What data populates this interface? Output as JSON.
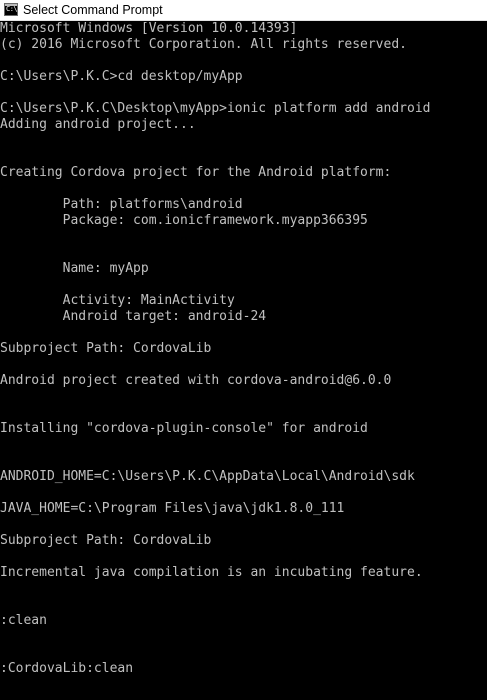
{
  "window": {
    "title": "Select Command Prompt",
    "icon_label": "C:\\"
  },
  "console": {
    "lines": [
      "Microsoft Windows [Version 10.0.14393]",
      "(c) 2016 Microsoft Corporation. All rights reserved.",
      "C:\\Users\\P.K.C>cd desktop/myApp",
      "C:\\Users\\P.K.C\\Desktop\\myApp>ionic platform add android",
      "Adding android project...",
      "Creating Cordova project for the Android platform:",
      "        Path: platforms\\android",
      "        Package: com.ionicframework.myapp366395",
      "        Name: myApp",
      "        Activity: MainActivity",
      "        Android target: android-24",
      "Subproject Path: CordovaLib",
      "Android project created with cordova-android@6.0.0",
      "Installing \"cordova-plugin-console\" for android",
      "ANDROID_HOME=C:\\Users\\P.K.C\\AppData\\Local\\Android\\sdk",
      "JAVA_HOME=C:\\Program Files\\java\\jdk1.8.0_111",
      "Subproject Path: CordovaLib",
      "Incremental java compilation is an incubating feature.",
      ":clean",
      ":CordovaLib:clean"
    ]
  },
  "colors": {
    "console_background": "#000000",
    "console_text": "#c0c0c0",
    "titlebar_background": "#ffffff",
    "titlebar_text": "#000000"
  },
  "icons": {
    "app": "command-prompt-icon"
  }
}
